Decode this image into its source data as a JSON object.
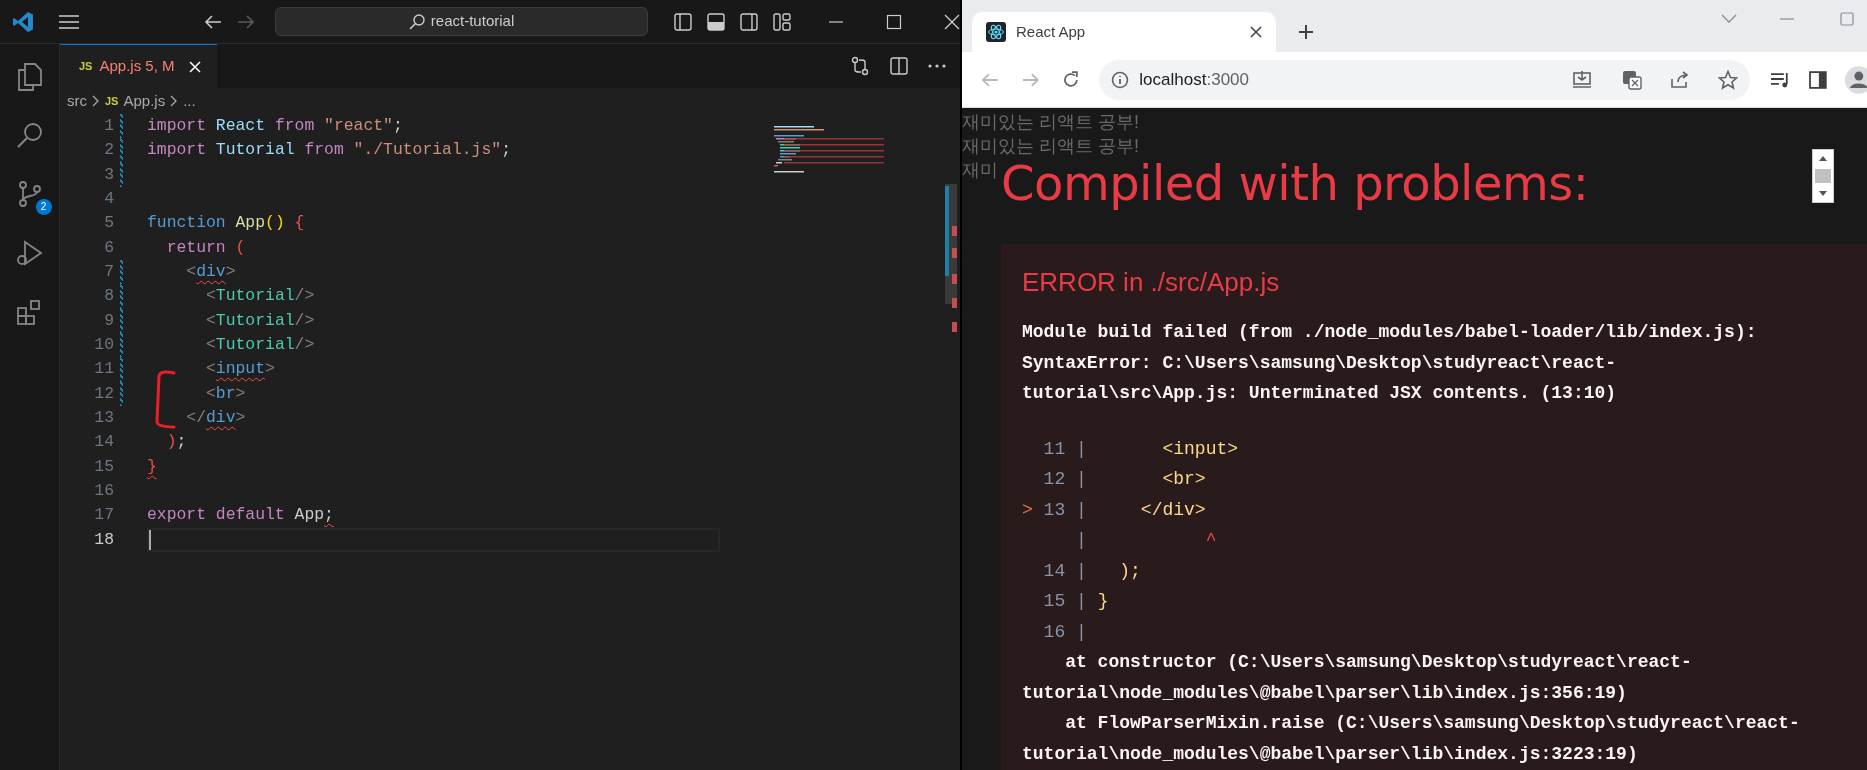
{
  "vscode": {
    "title_bar": {
      "search": "react-tutorial",
      "back_disabled": false,
      "forward_disabled": true
    },
    "activity_bar": {
      "source_control_badge": "2"
    },
    "tab": {
      "icon_text": "JS",
      "name": "App.js",
      "status": "5, M",
      "selected": true
    },
    "breadcrumb": {
      "folder": "src",
      "icon_text": "JS",
      "file": "App.js",
      "more": "..."
    },
    "lines": [
      {
        "number": "1",
        "modified": true,
        "current": false,
        "tokens": [
          {
            "text": "import ",
            "kind": "keyword"
          },
          {
            "text": "React ",
            "kind": "variable"
          },
          {
            "text": "from ",
            "kind": "keyword"
          },
          {
            "text": "\"react\"",
            "kind": "string"
          },
          {
            "text": ";",
            "kind": "plain"
          }
        ]
      },
      {
        "number": "2",
        "modified": true,
        "current": false,
        "tokens": [
          {
            "text": "import ",
            "kind": "keyword"
          },
          {
            "text": "Tutorial ",
            "kind": "variable"
          },
          {
            "text": "from ",
            "kind": "keyword"
          },
          {
            "text": "\"./Tutorial.js\"",
            "kind": "string"
          },
          {
            "text": ";",
            "kind": "plain"
          }
        ]
      },
      {
        "number": "3",
        "modified": true,
        "current": false
      },
      {
        "number": "4",
        "modified": false,
        "current": false
      },
      {
        "number": "5",
        "modified": false,
        "current": false,
        "tokens": [
          {
            "text": "function ",
            "kind": "storage"
          },
          {
            "text": "App",
            "kind": "function"
          },
          {
            "text": "() ",
            "kind": "bracket"
          },
          {
            "text": "{",
            "kind": "bad_bracket"
          }
        ]
      },
      {
        "number": "6",
        "modified": false,
        "current": false,
        "tokens": [
          {
            "text": "  return ",
            "kind": "keyword"
          },
          {
            "text": "(",
            "kind": "bad_bracket"
          }
        ]
      },
      {
        "number": "7",
        "modified": true,
        "current": false,
        "tokens": [
          {
            "text": "    <",
            "kind": "angle"
          },
          {
            "text": "div",
            "kind": "tag",
            "error": true
          },
          {
            "text": ">",
            "kind": "angle"
          }
        ]
      },
      {
        "number": "8",
        "modified": true,
        "current": false,
        "tokens": [
          {
            "text": "      <",
            "kind": "angle"
          },
          {
            "text": "Tutorial",
            "kind": "component"
          },
          {
            "text": "/>",
            "kind": "angle"
          }
        ]
      },
      {
        "number": "9",
        "modified": true,
        "current": false,
        "tokens": [
          {
            "text": "      <",
            "kind": "angle"
          },
          {
            "text": "Tutorial",
            "kind": "component"
          },
          {
            "text": "/>",
            "kind": "angle"
          }
        ]
      },
      {
        "number": "10",
        "modified": true,
        "current": false,
        "tokens": [
          {
            "text": "      <",
            "kind": "angle"
          },
          {
            "text": "Tutorial",
            "kind": "component"
          },
          {
            "text": "/>",
            "kind": "angle"
          }
        ]
      },
      {
        "number": "11",
        "modified": true,
        "current": false,
        "tokens": [
          {
            "text": "      <",
            "kind": "angle"
          },
          {
            "text": "input",
            "kind": "tag",
            "error": true
          },
          {
            "text": ">",
            "kind": "angle"
          }
        ]
      },
      {
        "number": "12",
        "modified": true,
        "current": false,
        "tokens": [
          {
            "text": "      <",
            "kind": "angle"
          },
          {
            "text": "br",
            "kind": "tag"
          },
          {
            "text": ">",
            "kind": "angle"
          }
        ]
      },
      {
        "number": "13",
        "modified": false,
        "current": false,
        "tokens": [
          {
            "text": "    </",
            "kind": "angle"
          },
          {
            "text": "div",
            "kind": "tag",
            "error": true
          },
          {
            "text": ">",
            "kind": "angle"
          }
        ]
      },
      {
        "number": "14",
        "modified": false,
        "current": false,
        "tokens": [
          {
            "text": "  )",
            "kind": "bad_bracket"
          },
          {
            "text": ";",
            "kind": "plain"
          }
        ]
      },
      {
        "number": "15",
        "modified": false,
        "current": false,
        "tokens": [
          {
            "text": "}",
            "kind": "bad_bracket",
            "error": true
          }
        ]
      },
      {
        "number": "16",
        "modified": false,
        "current": false
      },
      {
        "number": "17",
        "modified": false,
        "current": false,
        "tokens": [
          {
            "text": "export default ",
            "kind": "keyword"
          },
          {
            "text": "App",
            "kind": "plain"
          },
          {
            "text": ";",
            "kind": "plain",
            "error": true
          }
        ]
      },
      {
        "number": "18",
        "modified": false,
        "current": true
      }
    ]
  },
  "browser": {
    "tab": {
      "title": "React App",
      "selected": true
    },
    "nav": {
      "back_disabled": true,
      "forward_disabled": true
    },
    "address": {
      "host": "localhost",
      "port": ":3000"
    },
    "page": {
      "lines": [
        "재미있는 리액트 공부!",
        "재미있는 리액트 공부!",
        "재미"
      ]
    },
    "overlay": {
      "title": "Compiled with problems:",
      "error": {
        "heading": "ERROR in ./src/App.js",
        "message_lines": [
          "Module build failed (from ./node_modules/babel-loader/lib/index.js):",
          "SyntaxError: C:\\Users\\samsung\\Desktop\\studyreact\\react-",
          "tutorial\\src\\App.js: Unterminated JSX contents. (13:10)"
        ],
        "frame": [
          {
            "kind": "line",
            "number": "11",
            "separator": "|",
            "code": "      <input>"
          },
          {
            "kind": "line",
            "number": "12",
            "separator": "|",
            "code": "      <br>"
          },
          {
            "kind": "line",
            "marker": ">",
            "number": "13",
            "separator": "|",
            "code": "    </div>"
          },
          {
            "kind": "pointer",
            "separator": "|",
            "code": "          ^"
          },
          {
            "kind": "line",
            "number": "14",
            "separator": "|",
            "code": "  );"
          },
          {
            "kind": "line",
            "number": "15",
            "separator": "|",
            "code": "}"
          },
          {
            "kind": "line",
            "number": "16",
            "separator": "|"
          }
        ],
        "stack_lines": [
          "    at constructor (C:\\Users\\samsung\\Desktop\\studyreact\\react-",
          "tutorial\\node_modules\\@babel\\parser\\lib\\index.js:356:19)",
          "    at FlowParserMixin.raise (C:\\Users\\samsung\\Desktop\\studyreact\\react-",
          "tutorial\\node_modules\\@babel\\parser\\lib\\index.js:3223:19)"
        ]
      }
    }
  }
}
